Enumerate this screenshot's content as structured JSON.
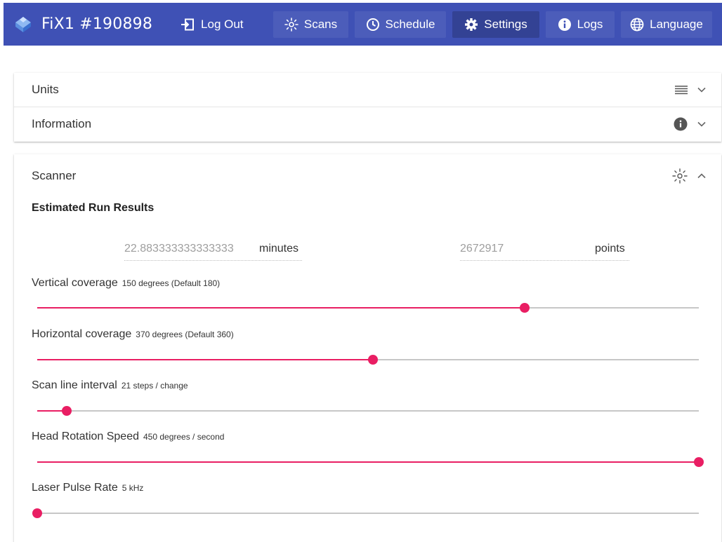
{
  "header": {
    "title": "FiX1 #190898",
    "logout_label": "Log Out",
    "nav": [
      {
        "label": "Scans",
        "icon": "scans-icon"
      },
      {
        "label": "Schedule",
        "icon": "clock-icon"
      },
      {
        "label": "Settings",
        "icon": "gear-icon",
        "active": true
      },
      {
        "label": "Logs",
        "icon": "info-icon"
      },
      {
        "label": "Language",
        "icon": "globe-icon"
      }
    ]
  },
  "panels": {
    "units": {
      "title": "Units",
      "icon": "list-icon",
      "chevron": "chevron-down-icon"
    },
    "information": {
      "title": "Information",
      "icon": "info-icon",
      "chevron": "chevron-down-icon"
    },
    "scanner": {
      "title": "Scanner",
      "icon": "scanner-icon",
      "chevron": "chevron-up-icon"
    }
  },
  "scanner": {
    "estimated_title": "Estimated Run Results",
    "estimate": {
      "minutes_value": "22.883333333333333",
      "minutes_label": "minutes",
      "points_value": "2672917",
      "points_label": "points"
    },
    "sliders": [
      {
        "label": "Vertical coverage",
        "hint": "150 degrees (Default 180)",
        "fraction": 0.737
      },
      {
        "label": "Horizontal coverage",
        "hint": "370 degrees (Default 360)",
        "fraction": 0.507
      },
      {
        "label": "Scan line interval",
        "hint": "21 steps / change",
        "fraction": 0.045
      },
      {
        "label": "Head Rotation Speed",
        "hint": "450 degrees / second",
        "fraction": 1.0
      },
      {
        "label": "Laser Pulse Rate",
        "hint": "5 kHz",
        "fraction": 0.0
      }
    ]
  },
  "colors": {
    "header_bg": "#3f51b5",
    "accent": "#e91e63",
    "track": "#c7c7c7"
  }
}
